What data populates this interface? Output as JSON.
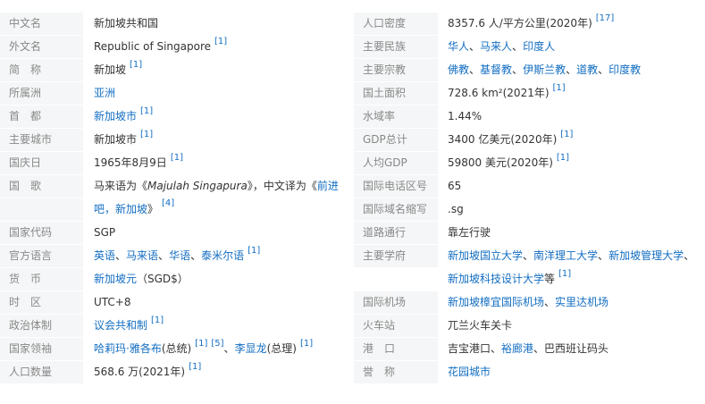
{
  "left": {
    "chinese_name": {
      "label": "中文名",
      "value": "新加坡共和国"
    },
    "foreign_name": {
      "label": "外文名",
      "value": "Republic of Singapore",
      "ref": "[1]"
    },
    "short_name": {
      "label": "简　称",
      "value": "新加坡",
      "ref": "[1]"
    },
    "continent": {
      "label": "所属洲",
      "value": "亚洲"
    },
    "capital": {
      "label": "首　都",
      "value": "新加坡市",
      "ref": "[1]"
    },
    "major_city": {
      "label": "主要城市",
      "value": "新加坡市",
      "ref": "[1]"
    },
    "national_day": {
      "label": "国庆日",
      "value": "1965年8月9日",
      "ref": "[1]"
    },
    "anthem": {
      "label": "国　歌",
      "prefix": "马来语为《",
      "malay": "Majulah Singapura",
      "mid": "》，中文译为《",
      "chinese_part1": "前进",
      "chinese_part2": "吧，新加坡",
      "suffix": "》",
      "ref": "[4]"
    },
    "country_code": {
      "label": "国家代码",
      "value": "SGP"
    },
    "official_language": {
      "label": "官方语言",
      "items": [
        "英语",
        "马来语",
        "华语",
        "泰米尔语"
      ],
      "separator": "、",
      "ref": "[1]"
    },
    "currency": {
      "label": "货　币",
      "value": "新加坡元",
      "suffix": "（SGD$）"
    },
    "time_zone": {
      "label": "时　区",
      "value": "UTC+8"
    },
    "political_system": {
      "label": "政治体制",
      "value": "议会共和制",
      "ref": "[1]"
    },
    "leaders": {
      "label": "国家领袖",
      "leader1": "哈莉玛·雅各布",
      "leader1_role": "(总统)",
      "ref1": "[1]",
      "ref2": "[5]",
      "sep": "、",
      "leader2": "李显龙",
      "leader2_role": "(总理)",
      "ref3": "[1]"
    },
    "population": {
      "label": "人口数量",
      "value": "568.6 万(2021年)",
      "ref": "[1]"
    }
  },
  "right": {
    "population_density": {
      "label": "人口密度",
      "value": "8357.6 人/平方公里(2020年)",
      "ref": "[17]"
    },
    "ethnic_groups": {
      "label": "主要民族",
      "items": [
        "华人",
        "马来人",
        "印度人"
      ],
      "separator": "、"
    },
    "religions": {
      "label": "主要宗教",
      "items": [
        "佛教",
        "基督教",
        "伊斯兰教",
        "道教",
        "印度教"
      ],
      "separator": "、"
    },
    "land_area": {
      "label": "国土面积",
      "value": "728.6 km²(2021年)",
      "ref": "[1]"
    },
    "water_rate": {
      "label": "水域率",
      "value": "1.44%"
    },
    "gdp_total": {
      "label": "GDP总计",
      "value": "3400 亿美元(2020年)",
      "ref": "[1]"
    },
    "gdp_per_capita": {
      "label": "人均GDP",
      "value": "59800 美元(2020年)",
      "ref": "[1]"
    },
    "dialing_code": {
      "label": "国际电话区号",
      "value": "65"
    },
    "tld": {
      "label": "国际域名缩写",
      "value": ".sg"
    },
    "driving": {
      "label": "道路通行",
      "value": "靠左行驶"
    },
    "universities": {
      "label": "主要学府",
      "line1_items": [
        "新加坡国立大学",
        "南洋理工大学",
        "新加坡管理大学"
      ],
      "line1_tail": "、",
      "line2_item": "新加坡科技设计大学",
      "line2_tail": "等",
      "separator": "、",
      "ref": "[1]"
    },
    "airports": {
      "label": "国际机场",
      "items": [
        "新加坡樟宜国际机场",
        "实里达机场"
      ],
      "separator": "、"
    },
    "train_station": {
      "label": "火车站",
      "value": "兀兰火车关卡"
    },
    "ports": {
      "label": "港　口",
      "prefix": "吉宝港口、",
      "link": "裕廊港",
      "suffix": "、巴西班让码头"
    },
    "nickname": {
      "label": "誉　称",
      "value": "花园城市"
    }
  },
  "colors": {
    "label_bg": "#f5f6f7",
    "label_text": "#888888",
    "link": "#136ec2",
    "text": "#333333"
  }
}
